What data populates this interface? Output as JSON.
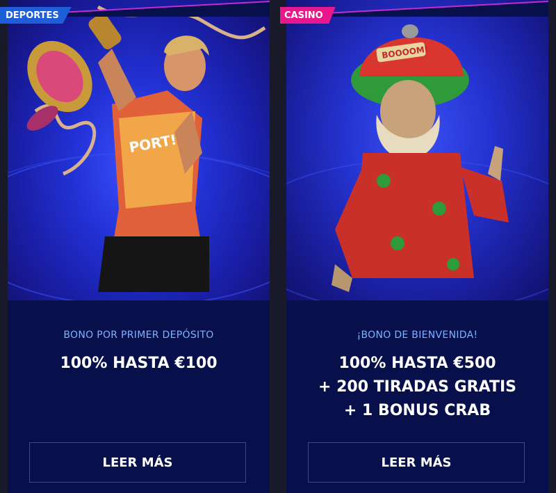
{
  "cards": [
    {
      "badge": "DEPORTES",
      "badge_color": "#1e5fd9",
      "subtitle": "BONO POR PRIMER DEPÓSITO",
      "headline_lines": [
        "100% HASTA €100"
      ],
      "cta_label": "LEER MÁS",
      "hero_image": "soccer-player-trophy"
    },
    {
      "badge": "CASINO",
      "badge_color": "#e8178c",
      "subtitle": "¡BONO DE BIENVENIDA!",
      "headline_lines": [
        "100% HASTA €500",
        "+ 200 TIRADAS GRATIS",
        "+ 1 BONUS CRAB"
      ],
      "cta_label": "LEER MÁS",
      "hero_image": "bearded-character-thumbs-up"
    }
  ],
  "colors": {
    "page_bg": "#181a2a",
    "card_bg": "#07104a",
    "subtitle": "#7fb2ff",
    "accent_divider": "#c22bd6"
  }
}
